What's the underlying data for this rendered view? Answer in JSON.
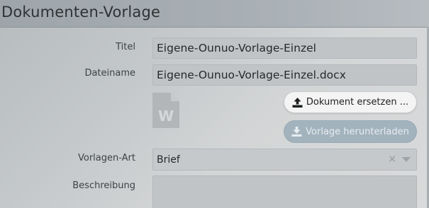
{
  "header": {
    "title": "Dokumenten-Vorlage"
  },
  "form": {
    "title_label": "Titel",
    "title_value": "Eigene-Ounuo-Vorlage-Einzel",
    "filename_label": "Dateiname",
    "filename_value": "Eigene-Ounuo-Vorlage-Einzel.docx",
    "template_type_label": "Vorlagen-Art",
    "template_type_value": "Brief",
    "description_label": "Beschreibung",
    "description_value": ""
  },
  "document": {
    "icon": "word-document-icon",
    "icon_letter": "W"
  },
  "buttons": {
    "replace_label": "Dokument ersetzen ...",
    "replace_icon": "upload-icon",
    "download_label": "Vorlage herunterladen",
    "download_icon": "download-icon"
  },
  "select": {
    "clear_glyph": "×",
    "clear_icon": "clear-x-icon",
    "dropdown_icon": "chevron-down-icon"
  },
  "colors": {
    "header_bg": "#a9b0b5",
    "field_bg": "#c1c4c7",
    "replace_button_bg": "#f4f4f4",
    "download_button_bg": "#a3b3be"
  }
}
